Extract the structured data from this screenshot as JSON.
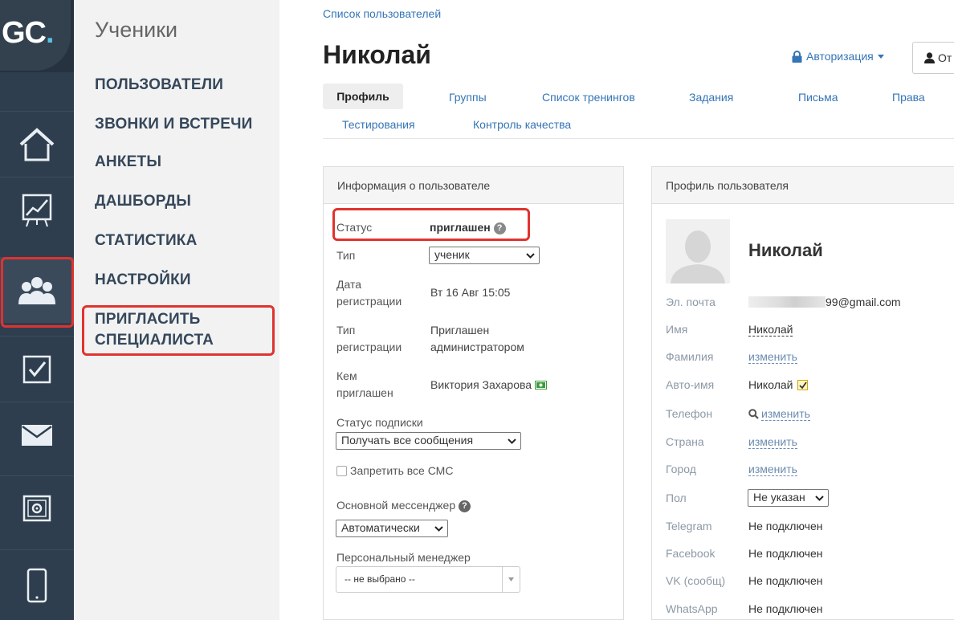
{
  "logo": {
    "main": "GC",
    "dot": "."
  },
  "rail": {
    "icons": [
      "home-icon",
      "chart-icon",
      "users-icon",
      "checkbox-icon",
      "mail-icon",
      "settings-box-icon",
      "phone-icon"
    ]
  },
  "submenu": {
    "title": "Ученики",
    "items": [
      "ПОЛЬЗОВАТЕЛИ",
      "ЗВОНКИ И ВСТРЕЧИ",
      "АНКЕТЫ",
      "ДАШБОРДЫ",
      "СТАТИСТИКА",
      "НАСТРОЙКИ"
    ],
    "invite_line1": "ПРИГЛАСИТЬ",
    "invite_line2": "СПЕЦИАЛИСТА"
  },
  "breadcrumb": "Список пользователей",
  "page_title": "Николай",
  "auth_label": "Авторизация",
  "ot_button": "От",
  "tabs": [
    "Профиль",
    "Группы",
    "Список тренингов",
    "Задания",
    "Письма",
    "Права",
    "Тестирования",
    "Контроль качества"
  ],
  "info": {
    "header": "Информация о пользователе",
    "status_label": "Статус",
    "status_value": "приглашен",
    "type_label": "Тип",
    "type_value": "ученик",
    "reg_date_label1": "Дата",
    "reg_date_label2": "регистрации",
    "reg_date_value": "Вт 16 Авг 15:05",
    "reg_type_label1": "Тип",
    "reg_type_label2": "регистрации",
    "reg_type_value1": "Приглашен",
    "reg_type_value2": "администратором",
    "invited_by_label1": "Кем",
    "invited_by_label2": "приглашен",
    "invited_by_value": "Виктория Захарова",
    "sub_status_label": "Статус подписки",
    "sub_status_value": "Получать все сообщения",
    "sms_label": "Запретить все СМС",
    "messenger_label": "Основной мессенджер",
    "messenger_value": "Автоматически",
    "manager_label": "Персональный менеджер",
    "manager_value": "-- не выбрано --"
  },
  "profile": {
    "header": "Профиль пользователя",
    "name": "Николай",
    "email_label": "Эл. почта",
    "email_value": "99@gmail.com",
    "first_label": "Имя",
    "first_value": "Николай",
    "last_label": "Фамилия",
    "last_value": "изменить",
    "auto_label": "Авто-имя",
    "auto_value": "Николай",
    "phone_label": "Телефон",
    "phone_value": "изменить",
    "country_label": "Страна",
    "country_value": "изменить",
    "city_label": "Город",
    "city_value": "изменить",
    "sex_label": "Пол",
    "sex_value": "Не указан",
    "telegram_label": "Telegram",
    "telegram_value": "Не подключен",
    "facebook_label": "Facebook",
    "facebook_value": "Не подключен",
    "vk_label": "VK (сообщ)",
    "vk_value": "Не подключен",
    "whatsapp_label": "WhatsApp",
    "whatsapp_value": "Не подключен"
  },
  "colors": {
    "highlight": "#e0332f",
    "link": "#3575b5",
    "rail": "#2f3e4e"
  }
}
